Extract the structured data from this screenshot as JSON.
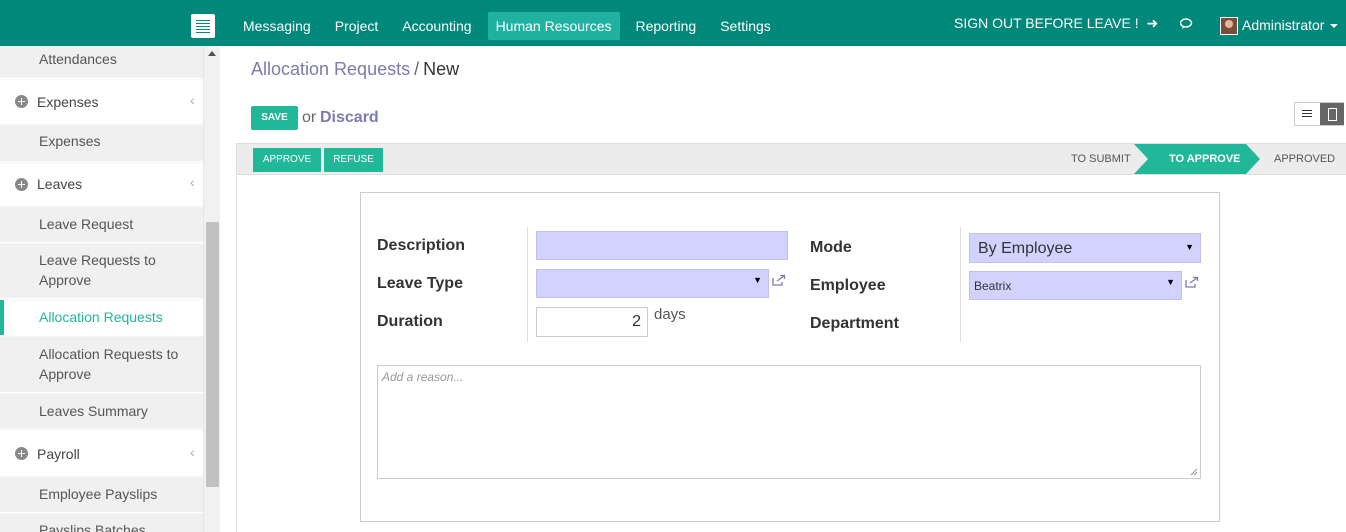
{
  "navbar": {
    "menu": [
      "Messaging",
      "Project",
      "Accounting",
      "Human Resources",
      "Reporting",
      "Settings"
    ],
    "active_menu": "Human Resources",
    "sign_out": "SIGN OUT BEFORE LEAVE !",
    "user": "Administrator"
  },
  "sidebar": {
    "items": [
      {
        "label": "Attendances",
        "kind": "sub"
      },
      {
        "label": "Expenses",
        "kind": "category"
      },
      {
        "label": "Expenses",
        "kind": "sub"
      },
      {
        "label": "Leaves",
        "kind": "category"
      },
      {
        "label": "Leave Request",
        "kind": "sub"
      },
      {
        "label": "Leave Requests to Approve",
        "kind": "sub"
      },
      {
        "label": "Allocation Requests",
        "kind": "sub",
        "active": true
      },
      {
        "label": "Allocation Requests to Approve",
        "kind": "sub"
      },
      {
        "label": "Leaves Summary",
        "kind": "sub"
      },
      {
        "label": "Payroll",
        "kind": "category"
      },
      {
        "label": "Employee Payslips",
        "kind": "sub"
      },
      {
        "label": "Payslips Batches",
        "kind": "sub"
      }
    ]
  },
  "breadcrumb": {
    "parent": "Allocation Requests",
    "separator": "/",
    "current": "New"
  },
  "actions": {
    "save": "SAVE",
    "or": "or",
    "discard": "Discard"
  },
  "statusbar": {
    "buttons": [
      "APPROVE",
      "REFUSE"
    ],
    "stages": [
      "TO SUBMIT",
      "TO APPROVE",
      "APPROVED"
    ],
    "active_stage": "TO APPROVE"
  },
  "form": {
    "description_label": "Description",
    "description_value": "",
    "leave_type_label": "Leave Type",
    "leave_type_value": "",
    "duration_label": "Duration",
    "duration_value": "2",
    "duration_unit": "days",
    "mode_label": "Mode",
    "mode_value": "By Employee",
    "employee_label": "Employee",
    "employee_value": "Beatrix",
    "department_label": "Department",
    "reason_placeholder": "Add a reason..."
  },
  "colors": {
    "navbar": "#00897b",
    "accent": "#21b799",
    "required_field": "#d2d2ff",
    "link": "#7c7bad"
  }
}
